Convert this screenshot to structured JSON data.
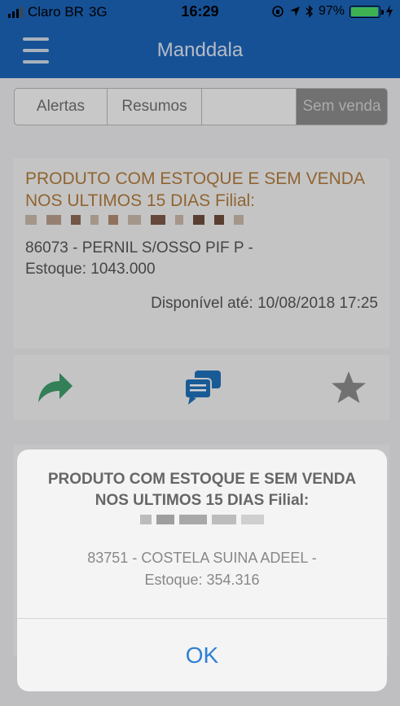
{
  "status": {
    "carrier": "Claro BR",
    "network": "3G",
    "time": "16:29",
    "battery": "97%",
    "battery_level": 0.97
  },
  "navbar": {
    "title": "Manddala"
  },
  "tabs": [
    {
      "label": "Alertas"
    },
    {
      "label": "Resumos"
    },
    {
      "label": ""
    },
    {
      "label": "Sem venda"
    }
  ],
  "card": {
    "title": "PRODUTO COM ESTOQUE E SEM VENDA NOS ULTIMOS 15 DIAS Filial:",
    "line1": "86073 - PERNIL S/OSSO PIF P -",
    "line2": "Estoque: 1043.000",
    "date": "Disponível até: 10/08/2018 17:25"
  },
  "actions": {
    "icons": [
      "share-arrow-icon",
      "chat-icon",
      "star-icon"
    ],
    "colors": {
      "share": "#3f9b6b",
      "chat": "#1f6fb8",
      "star": "#8a8a8a"
    }
  },
  "alert": {
    "title": "PRODUTO COM ESTOQUE E SEM VENDA NOS ULTIMOS 15 DIAS Filial:",
    "line1": "83751 - COSTELA SUINA ADEEL -",
    "line2": "Estoque: 354.316",
    "ok": "OK"
  },
  "colors": {
    "brand": "#1b63b8",
    "accent_title": "#b07a3c",
    "ok": "#2f7fd6"
  }
}
